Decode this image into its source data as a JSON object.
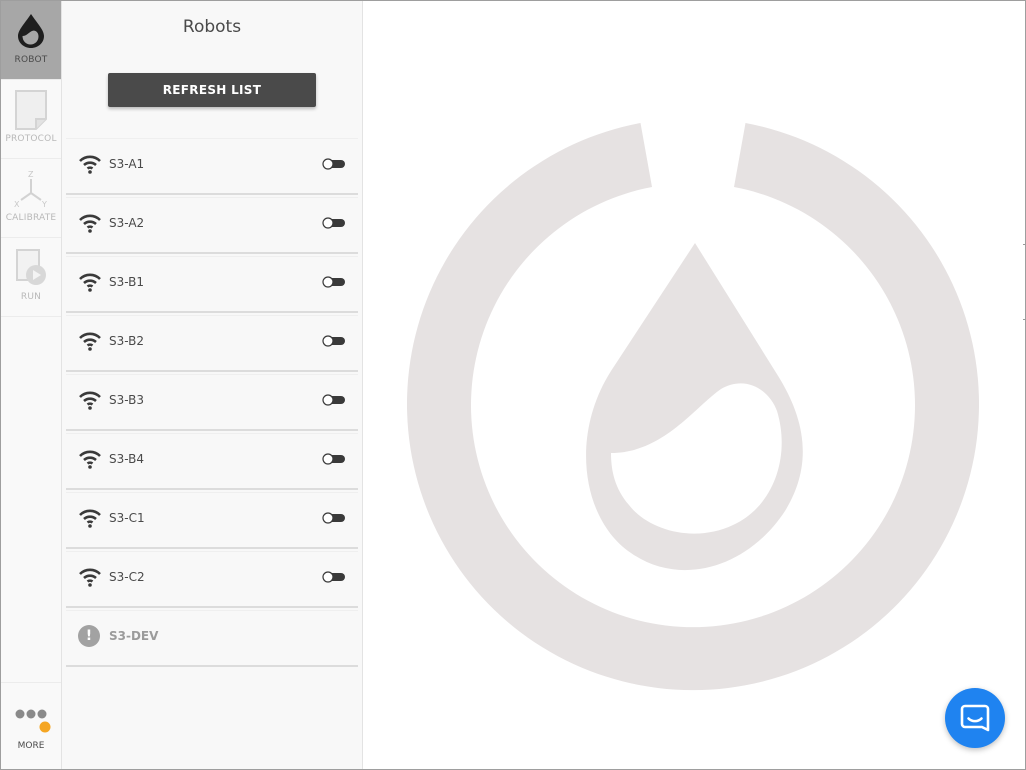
{
  "nav": {
    "items": [
      {
        "label": "ROBOT",
        "icon": "opentrons-drop-icon",
        "active": true
      },
      {
        "label": "PROTOCOL",
        "icon": "document-icon",
        "active": false
      },
      {
        "label": "CALIBRATE",
        "icon": "xyz-axes-icon",
        "active": false
      },
      {
        "label": "RUN",
        "icon": "play-document-icon",
        "active": false
      }
    ],
    "more": {
      "label": "MORE",
      "icon": "more-dots-icon",
      "badge_color": "#f5a623"
    }
  },
  "panel": {
    "title": "Robots",
    "refresh_label": "REFRESH LIST",
    "robots": [
      {
        "name": "S3-A1",
        "status": "connectable"
      },
      {
        "name": "S3-A2",
        "status": "connectable"
      },
      {
        "name": "S3-B1",
        "status": "connectable"
      },
      {
        "name": "S3-B2",
        "status": "connectable"
      },
      {
        "name": "S3-B3",
        "status": "connectable"
      },
      {
        "name": "S3-B4",
        "status": "connectable"
      },
      {
        "name": "S3-C1",
        "status": "connectable"
      },
      {
        "name": "S3-C2",
        "status": "connectable"
      }
    ],
    "unavailable_robot": {
      "name": "S3-DEV",
      "icon": "alert-icon",
      "symbol": "!"
    }
  },
  "colors": {
    "dark": "#4a4a4a",
    "watermark": "#e6e2e2",
    "chat_button": "#1f83f0",
    "nav_active": "#a7a7a7"
  },
  "chat": {
    "icon": "chat-icon"
  }
}
